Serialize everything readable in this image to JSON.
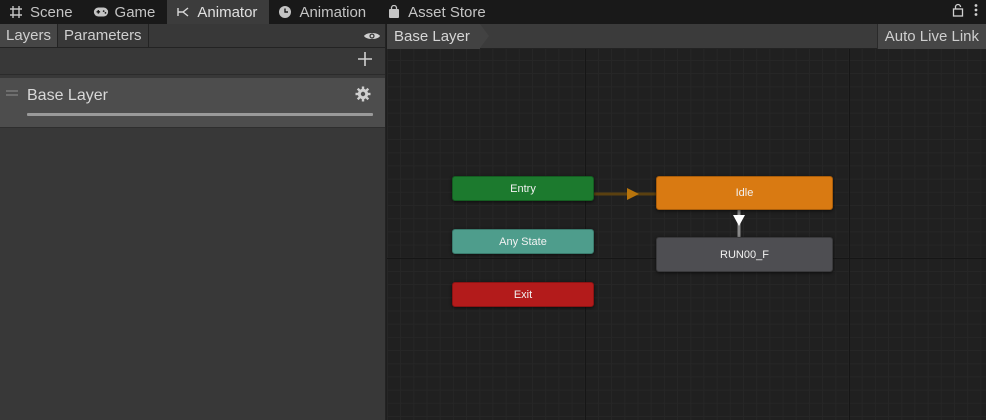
{
  "tabs": [
    {
      "label": "Scene",
      "icon": "grid-icon"
    },
    {
      "label": "Game",
      "icon": "gamepad-icon"
    },
    {
      "label": "Animator",
      "icon": "animator-icon",
      "active": true
    },
    {
      "label": "Animation",
      "icon": "clock-icon"
    },
    {
      "label": "Asset Store",
      "icon": "bag-icon"
    }
  ],
  "left_tabs": {
    "layers": "Layers",
    "parameters": "Parameters"
  },
  "layer": {
    "name": "Base Layer"
  },
  "graph": {
    "breadcrumb": "Base Layer",
    "auto_live_link": "Auto Live Link",
    "nodes": {
      "entry": "Entry",
      "any_state": "Any State",
      "exit": "Exit",
      "idle": "Idle",
      "run": "RUN00_F"
    }
  },
  "colors": {
    "entry": "#1c7a2e",
    "any_state": "#4e9d8c",
    "exit": "#b31b1b",
    "default_state": "#d97a12",
    "state": "#4e4e52"
  }
}
